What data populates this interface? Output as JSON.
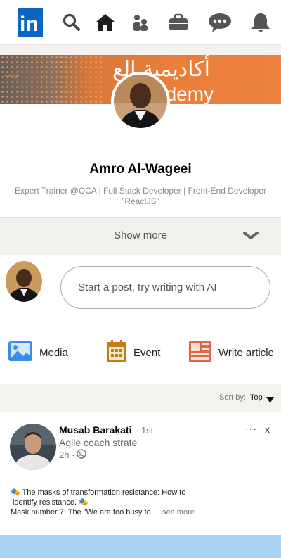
{
  "nav": {
    "logo": "in",
    "icons": [
      "search-icon",
      "home-icon",
      "my-network-icon",
      "jobs-icon",
      "messaging-icon",
      "notifications-icon"
    ]
  },
  "profile": {
    "banner_brand": "orange",
    "banner_arabic": "أكاديمية الع",
    "banner_english": "ademy",
    "name": "Amro Al-Wageei",
    "headline": "Expert Trainer @OCA | Full Stack Developer | Front-End Developer \"ReactJS\"",
    "show_more": "Show more"
  },
  "composer": {
    "placeholder": "Start a post, try writing with AI",
    "actions": [
      {
        "label": "Media",
        "icon": "media-icon",
        "color": "#378fe9"
      },
      {
        "label": "Event",
        "icon": "event-icon",
        "color": "#c37d16"
      },
      {
        "label": "Write article",
        "icon": "write-article-icon",
        "color": "#e06847"
      }
    ]
  },
  "feed": {
    "sort_prefix": "Sort by:",
    "sort_value": "Top"
  },
  "post": {
    "author": "Musab Barakati",
    "degree": "· 1st",
    "subtitle": "Agile coach strate",
    "time": "2h ·",
    "more": "···",
    "close": "x",
    "line1": "🎭 The masks of transformation resistance: How to",
    "line2": "identify resistance. 🎭",
    "line3": "Mask number 7: The \"We are too busy to",
    "see_more": "...see more"
  },
  "colors": {
    "linkedin_blue": "#0a66c2",
    "nav_icon": "#444444"
  }
}
